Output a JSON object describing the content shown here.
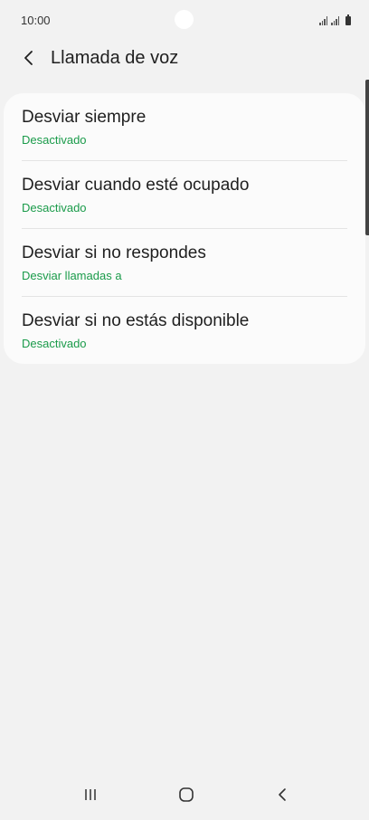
{
  "status_bar": {
    "time": "10:00"
  },
  "header": {
    "title": "Llamada de voz",
    "back_icon": "chevron-left-icon"
  },
  "forwarding_options": [
    {
      "title": "Desviar siempre",
      "status": "Desactivado"
    },
    {
      "title": "Desviar cuando esté ocupado",
      "status": "Desactivado"
    },
    {
      "title": "Desviar si no respondes",
      "status": "Desviar llamadas a"
    },
    {
      "title": "Desviar si no estás disponible",
      "status": "Desactivado"
    }
  ],
  "navigation": {
    "recent_icon": "recent-apps-icon",
    "home_icon": "home-icon",
    "back_icon": "back-icon"
  },
  "colors": {
    "background": "#f2f2f2",
    "card": "#fbfbfb",
    "accent_status": "#1a9b4a",
    "text_primary": "#1f1f1f"
  }
}
